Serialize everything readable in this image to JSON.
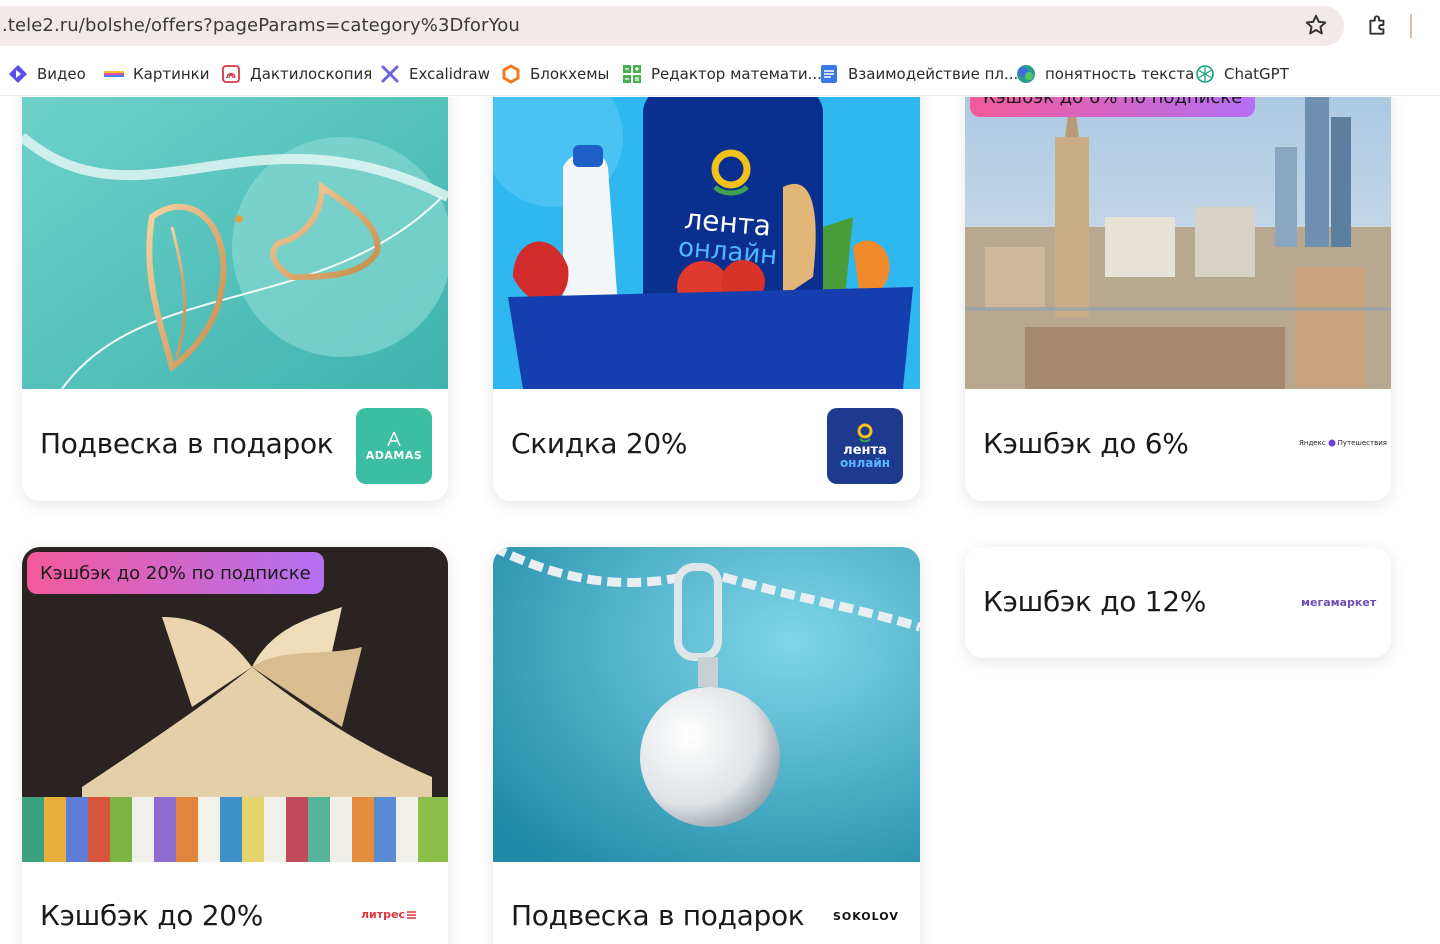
{
  "browser": {
    "url": ".tele2.ru/bolshe/offers?pageParams=category%3DforYou",
    "bookmarks": [
      {
        "label": "Видео",
        "icon": "video-icon"
      },
      {
        "label": "Картинки",
        "icon": "images-icon"
      },
      {
        "label": "Дактилоскопия",
        "icon": "fingerprint-icon"
      },
      {
        "label": "Excalidraw",
        "icon": "excalidraw-icon"
      },
      {
        "label": "Блокхемы",
        "icon": "flowchart-icon"
      },
      {
        "label": "Редактор математи...",
        "icon": "math-editor-icon"
      },
      {
        "label": "Взаимодействие пл...",
        "icon": "docs-icon"
      },
      {
        "label": "понятность текста",
        "icon": "globe-icon"
      },
      {
        "label": "ChatGPT",
        "icon": "chatgpt-icon"
      }
    ]
  },
  "offers": [
    {
      "title": "Подвеска в подарок",
      "brand": "ADAMAS",
      "badge": ""
    },
    {
      "title": "Скидка 20%",
      "brand": "лента онлайн",
      "badge": ""
    },
    {
      "title": "Кэшбэк до 6%",
      "brand": "Яндекс Путешествия",
      "badge": "Кэшбэк до 6% по подписке"
    },
    {
      "title": "Кэшбэк до 20%",
      "brand": "литрес",
      "badge": "Кэшбэк до 20% по подписке"
    },
    {
      "title": "Подвеска в подарок",
      "brand": "SOKOLOV",
      "badge": ""
    },
    {
      "title": "Кэшбэк до 12%",
      "brand": "мегамаркет",
      "badge": ""
    }
  ],
  "brand_lines": {
    "lenta_top": "лента",
    "lenta_bottom": "онлайн",
    "yandex_left": "Яндекс",
    "yandex_right": "Путешествия"
  },
  "colors": {
    "badge_gradient_start": "#f35a9a",
    "badge_gradient_end": "#b470f4",
    "adamas_bg": "#3cbfa1",
    "lenta_bg": "#1d3a8f",
    "megamarket": "#6e4fb8",
    "litres": "#e2343d"
  }
}
